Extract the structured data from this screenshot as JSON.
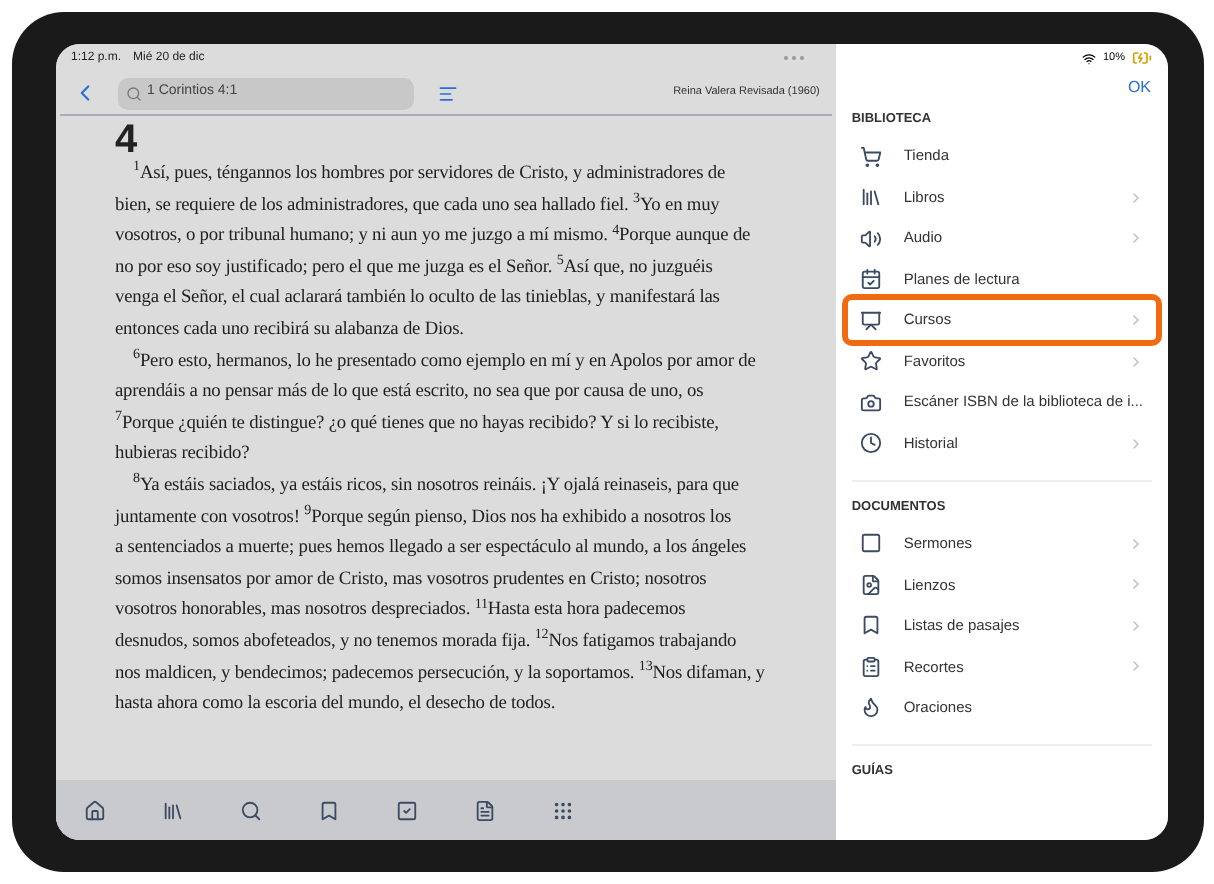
{
  "status_bar": {
    "time": "1:12 p.m.",
    "date": "Mié 20 de dic",
    "battery": "10%"
  },
  "toolbar": {
    "search": {
      "value": "1 Corintios 4:1"
    },
    "version": "Reina Valera Revisada (1960)"
  },
  "chapter": "4",
  "lines": [
    {
      "text": "$^{1}$Así, pues, téngannos los hombres por servidores de Cristo, y administradores de",
      "indent": true
    },
    {
      "text": "bien, se requiere de los administradores, que cada uno sea hallado fiel. $^{3}$Yo en muy",
      "indent": false
    },
    {
      "text": "vosotros, o por tribunal humano; y ni aun yo me juzgo a mí mismo. $^{4}$Porque aunque de",
      "indent": false
    },
    {
      "text": "no por eso soy justificado; pero el que me juzga es el Señor. $^{5}$Así que, no juzguéis",
      "indent": false
    },
    {
      "text": "venga el Señor, el cual aclarará también lo oculto de las tinieblas, y manifestará las",
      "indent": false
    },
    {
      "text": "entonces cada uno recibirá su alabanza de Dios.",
      "indent": false
    },
    {
      "text": "$^{6}$Pero esto, hermanos, lo he presentado como ejemplo en mí y en Apolos por amor de",
      "indent": true
    },
    {
      "text": "aprendáis a no pensar más de lo que está escrito, no sea que por causa de uno, os",
      "indent": false
    },
    {
      "text": "$^{7}$Porque ¿quién te distingue? ¿o qué tienes que no hayas recibido? Y si lo recibiste,",
      "indent": false
    },
    {
      "text": "hubieras recibido?",
      "indent": false
    },
    {
      "text": "$^{8}$Ya estáis saciados, ya estáis ricos, sin nosotros reináis. ¡Y ojalá reinaseis, para que",
      "indent": true
    },
    {
      "text": "juntamente con vosotros! $^{9}$Porque según pienso, Dios nos ha exhibido a nosotros los",
      "indent": false
    },
    {
      "text": "a sentenciados a muerte; pues hemos llegado a ser espectáculo al mundo, a los ángeles",
      "indent": false
    },
    {
      "text": "somos insensatos por amor de Cristo, mas vosotros prudentes en Cristo; nosotros",
      "indent": false
    },
    {
      "text": "vosotros honorables, mas nosotros despreciados. $^{11}$Hasta esta hora padecemos",
      "indent": false
    },
    {
      "text": "desnudos, somos abofeteados, y no tenemos morada fija. $^{12}$Nos fatigamos trabajando",
      "indent": false
    },
    {
      "text": "nos maldicen, y bendecimos; padecemos persecución, y la soportamos. $^{13}$Nos difaman, y",
      "indent": false
    },
    {
      "text": "hasta ahora como la escoria del mundo, el desecho de todos.",
      "indent": false
    }
  ],
  "panel": {
    "ok": "OK",
    "sections": [
      {
        "title": "BIBLIOTECA",
        "items": [
          {
            "label": "Tienda",
            "chevron": false,
            "highlighted": false
          },
          {
            "label": "Libros",
            "chevron": true,
            "highlighted": false
          },
          {
            "label": "Audio",
            "chevron": true,
            "highlighted": false
          },
          {
            "label": "Planes de lectura",
            "chevron": false,
            "highlighted": false
          },
          {
            "label": "Cursos",
            "chevron": true,
            "highlighted": true
          },
          {
            "label": "Favoritos",
            "chevron": true,
            "highlighted": false
          },
          {
            "label": "Escáner ISBN de la biblioteca de i...",
            "chevron": false,
            "highlighted": false
          },
          {
            "label": "Historial",
            "chevron": true,
            "highlighted": false
          }
        ]
      },
      {
        "title": "DOCUMENTOS",
        "items": [
          {
            "label": "Sermones",
            "chevron": true,
            "highlighted": false
          },
          {
            "label": "Lienzos",
            "chevron": true,
            "highlighted": false
          },
          {
            "label": "Listas de pasajes",
            "chevron": true,
            "highlighted": false
          },
          {
            "label": "Recortes",
            "chevron": true,
            "highlighted": false
          },
          {
            "label": "Oraciones",
            "chevron": false,
            "highlighted": false
          }
        ]
      },
      {
        "title": "GUÍAS"
      }
    ]
  }
}
